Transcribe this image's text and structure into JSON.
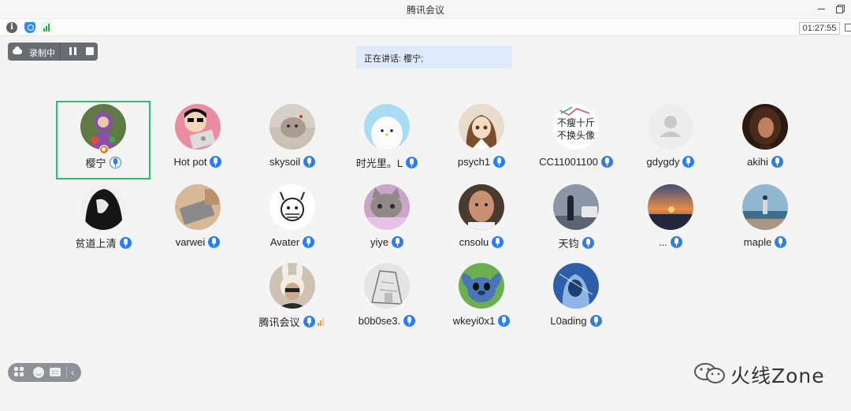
{
  "window": {
    "title": "腾讯会议"
  },
  "toolbar": {
    "timer": "01:27:55"
  },
  "recording": {
    "label": "录制中"
  },
  "speaking": {
    "text": "正在讲话: 樱宁;"
  },
  "participants": [
    {
      "name": "樱宁",
      "active": true,
      "avatar": "teletubby-purple"
    },
    {
      "name": "Hot pot",
      "avatar": "cartoon-boy-laptop"
    },
    {
      "name": "skysoil",
      "avatar": "grey-cat"
    },
    {
      "name": "时光里。L",
      "avatar": "white-chick"
    },
    {
      "name": "psych1",
      "avatar": "anime-girl"
    },
    {
      "name": "CC11001100",
      "avatar": "text-image"
    },
    {
      "name": "gdygdy",
      "avatar": "default-person"
    },
    {
      "name": "akihi",
      "avatar": "curly-hair-woman"
    },
    {
      "name": "贫道上清",
      "avatar": "dark-ink-figure"
    },
    {
      "name": "varwei",
      "avatar": "laptop-desk"
    },
    {
      "name": "Avater",
      "avatar": "line-drawing-face"
    },
    {
      "name": "yiye",
      "avatar": "cat-purple"
    },
    {
      "name": "cnsolu",
      "avatar": "bald-man"
    },
    {
      "name": "天钧",
      "avatar": "street-person"
    },
    {
      "name": "...",
      "avatar": "sunset-beach"
    },
    {
      "name": "maple",
      "avatar": "coast-person"
    },
    {
      "name": "腾讯会议",
      "avatar": "bunny-hat-person",
      "volume": true
    },
    {
      "name": "b0b0se3.",
      "avatar": "sketch-room"
    },
    {
      "name": "wkeyi0x1",
      "avatar": "stitch"
    },
    {
      "name": "L0ading",
      "avatar": "blue-hoodie"
    }
  ],
  "avatar_text": {
    "line1": "不瘦十斤",
    "line2": "不换头像"
  },
  "watermark": {
    "text": "火线Zone"
  },
  "colors": {
    "accent": "#2b7ef2",
    "active_border": "#27c26c",
    "host_badge": "#f07d26",
    "banner_bg": "#dfeafd"
  }
}
